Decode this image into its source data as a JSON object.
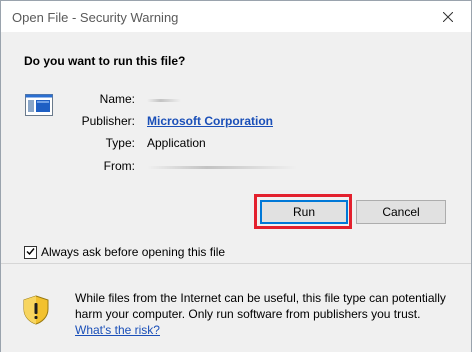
{
  "window": {
    "title": "Open File - Security Warning"
  },
  "dialog": {
    "heading": "Do you want to run this file?",
    "fields": {
      "name_label": "Name:",
      "publisher_label": "Publisher:",
      "publisher_value": "Microsoft Corporation",
      "type_label": "Type:",
      "type_value": "Application",
      "from_label": "From:"
    },
    "buttons": {
      "run": "Run",
      "cancel": "Cancel"
    },
    "checkbox": {
      "label": "Always ask before opening this file",
      "checked": true
    }
  },
  "warning": {
    "text": "While files from the Internet can be useful, this file type can potentially harm your computer. Only run software from publishers you trust.",
    "link": "What's the risk?"
  },
  "colors": {
    "link": "#1a4fb8",
    "highlight": "#e3202d",
    "shield_yellow": "#f2c12e"
  }
}
